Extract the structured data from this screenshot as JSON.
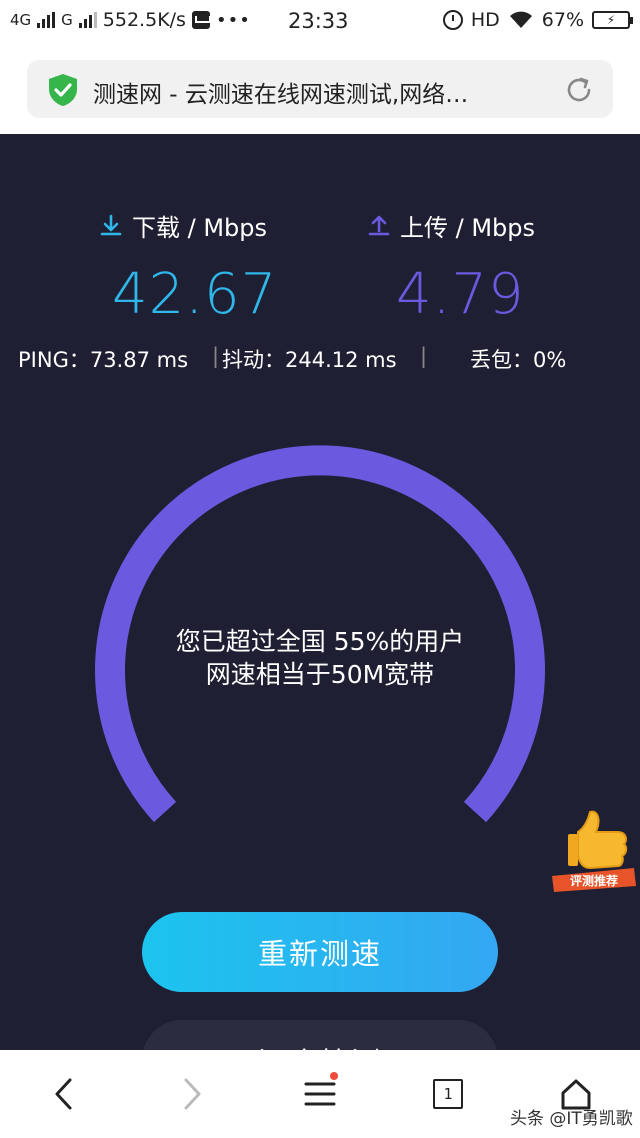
{
  "status_bar": {
    "net1": "4G",
    "net2": "G",
    "speed": "552.5K/s",
    "dots": "•••",
    "time": "23:33",
    "hd": "HD",
    "battery_percent": "67%"
  },
  "browser": {
    "page_title": "测速网 - 云测速在线网速测试,网络…"
  },
  "speedtest": {
    "download_label": "下载 / Mbps",
    "download_value": "42.67",
    "upload_label": "上传 / Mbps",
    "upload_value": "4.79",
    "ping": "PING：73.87 ms",
    "jitter": "抖动：244.12 ms",
    "packet_loss": "丢包：0%",
    "separator": "|",
    "gauge_line1": "您已超过全国 55%的用户",
    "gauge_line2": "网速相当于50M宽带",
    "percentile": 55,
    "retest_label": "重新测速",
    "second_button_label": "深度检测",
    "badge_text": "评测推荐"
  },
  "colors": {
    "panel_bg": "#1f1f33",
    "download": "#2fb7ea",
    "upload": "#6a5ae0",
    "gauge": "#6a5ae0",
    "button": "#1cc4ee"
  },
  "bottom_nav": {
    "tab_count": "1",
    "watermark": "头条 @IT勇凯歌",
    "icons": [
      "back-icon",
      "forward-icon",
      "menu-icon",
      "tabs-icon",
      "home-icon"
    ]
  }
}
